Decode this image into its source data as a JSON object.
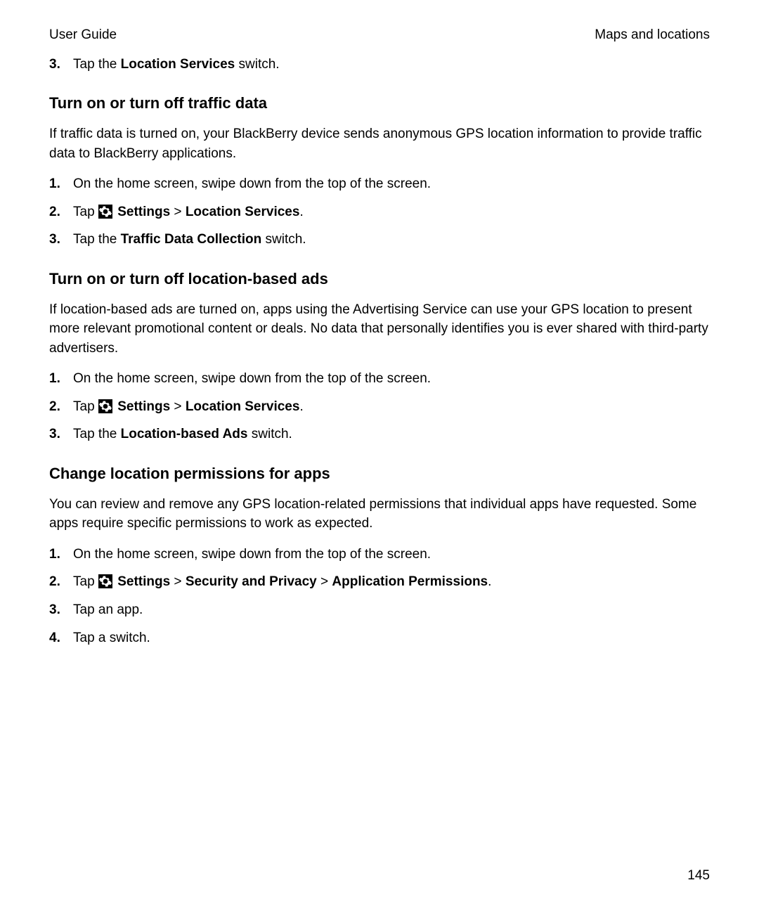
{
  "header": {
    "left": "User Guide",
    "right": "Maps and locations"
  },
  "cont_step3": {
    "num": "3.",
    "prefix": "Tap the ",
    "bold": "Location Services",
    "suffix": " switch."
  },
  "sections": [
    {
      "heading": "Turn on or turn off traffic data",
      "para": "If traffic data is turned on, your BlackBerry device sends anonymous GPS location information to provide traffic data to BlackBerry applications.",
      "steps": [
        {
          "parts": [
            {
              "text": "On the home screen, swipe down from the top of the screen."
            }
          ]
        },
        {
          "parts": [
            {
              "text": "Tap "
            },
            {
              "icon": true
            },
            {
              "text": " "
            },
            {
              "bold": true,
              "text": "Settings"
            },
            {
              "text": " > "
            },
            {
              "bold": true,
              "text": "Location Services"
            },
            {
              "text": "."
            }
          ]
        },
        {
          "parts": [
            {
              "text": "Tap the "
            },
            {
              "bold": true,
              "text": "Traffic Data Collection"
            },
            {
              "text": " switch."
            }
          ]
        }
      ]
    },
    {
      "heading": "Turn on or turn off location-based ads",
      "para": "If location-based ads are turned on, apps using the Advertising Service can use your GPS location to present more relevant promotional content or deals. No data that personally identifies you is ever shared with third-party advertisers.",
      "steps": [
        {
          "parts": [
            {
              "text": "On the home screen, swipe down from the top of the screen."
            }
          ]
        },
        {
          "parts": [
            {
              "text": "Tap "
            },
            {
              "icon": true
            },
            {
              "text": " "
            },
            {
              "bold": true,
              "text": "Settings"
            },
            {
              "text": " > "
            },
            {
              "bold": true,
              "text": "Location Services"
            },
            {
              "text": "."
            }
          ]
        },
        {
          "parts": [
            {
              "text": "Tap the "
            },
            {
              "bold": true,
              "text": "Location-based Ads"
            },
            {
              "text": " switch."
            }
          ]
        }
      ]
    },
    {
      "heading": "Change location permissions for apps",
      "para": "You can review and remove any GPS location-related permissions that individual apps have requested. Some apps require specific permissions to work as expected.",
      "steps": [
        {
          "parts": [
            {
              "text": "On the home screen, swipe down from the top of the screen."
            }
          ]
        },
        {
          "parts": [
            {
              "text": "Tap "
            },
            {
              "icon": true
            },
            {
              "text": " "
            },
            {
              "bold": true,
              "text": "Settings"
            },
            {
              "text": " > "
            },
            {
              "bold": true,
              "text": "Security and Privacy"
            },
            {
              "text": " > "
            },
            {
              "bold": true,
              "text": "Application Permissions"
            },
            {
              "text": "."
            }
          ]
        },
        {
          "parts": [
            {
              "text": "Tap an app."
            }
          ]
        },
        {
          "parts": [
            {
              "text": "Tap a switch."
            }
          ]
        }
      ]
    }
  ],
  "page_number": "145"
}
